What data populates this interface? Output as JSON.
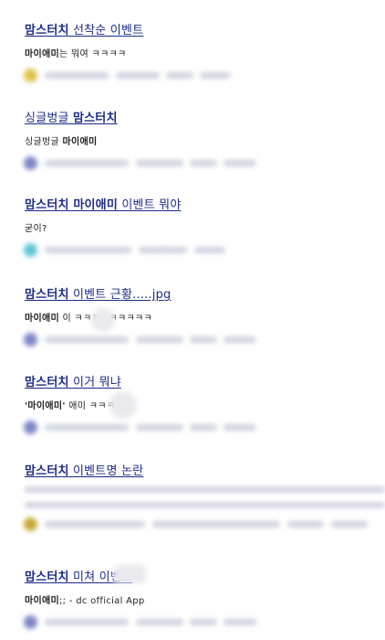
{
  "results": [
    {
      "title_hl": "맘스터치",
      "title_rest": " 선착순 이벤트",
      "snippet_hl": "마이애미",
      "snippet_rest": "는 뭐여 ㅋㅋㅋㅋ",
      "avatar_color": "#e0c24a"
    },
    {
      "title_pre": "싱글벙글 ",
      "title_hl": "맘스터치",
      "snippet_pre": "싱글벙글 ",
      "snippet_hl": "마이애미",
      "avatar_color": "#7f86c7"
    },
    {
      "title_hl": "맘스터치 마이애미",
      "title_rest": " 이벤트 뭐야",
      "snippet_rest": "굳이?",
      "avatar_color": "#5fc6d6"
    },
    {
      "title_hl": "맘스터치",
      "title_rest": " 이벤트 근황.....jpg",
      "snippet_hl": "마이애미",
      "snippet_rest": " 이        ㅋㅋㅋㅋㅋㅋㅋㅋㅋ",
      "avatar_color": "#7f86c7"
    },
    {
      "title_hl": "맘스터치",
      "title_rest": " 이거 뭐냐",
      "snippet_hl": "'마이애미'",
      "snippet_rest": " 애미        ㅋㅋㅋㅋ",
      "avatar_color": "#7f86c7"
    },
    {
      "title_hl": "맘스터치",
      "title_rest": " 이벤트명 논란",
      "avatar_color": "#c9a83a"
    },
    {
      "title_hl": "맘스터치",
      "title_rest": " 미쳐       이벤트",
      "snippet_hl": "마이애미",
      "snippet_rest": ";; - dc official App",
      "avatar_color": "#7f86c7"
    }
  ]
}
